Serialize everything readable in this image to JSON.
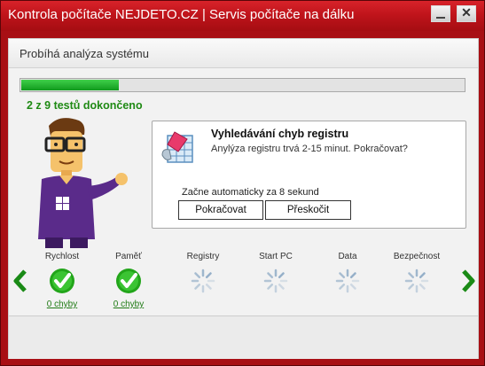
{
  "window": {
    "title": "Kontrola počítače NEJDETO.CZ | Servis počítače na dálku",
    "minimize_icon": "minimize-icon",
    "close_icon": "close-icon",
    "close_glyph": "✕"
  },
  "colors": {
    "titlebar": "#c0141b",
    "progress_green": "#1fb52c",
    "status_green": "#1f8a14",
    "check_green": "#22a51a"
  },
  "panel": {
    "header": "Probíhá analýza systému",
    "progress_fraction": 0.22,
    "count_text": "2 z 9 testů dokončeno"
  },
  "dialog": {
    "icon": "registry-icon",
    "title": "Vyhledávání chyb registru",
    "subtitle": "Anylýza registru trvá 2-15 minut. Pokračovat?",
    "auto_text": "Začne automaticky za 8 sekund",
    "continue_label": "Pokračovat",
    "skip_label": "Přeskočit"
  },
  "steps": [
    {
      "label": "Rychlost",
      "status": "done",
      "icon": "check-icon",
      "link": "0 chyby"
    },
    {
      "label": "Paměť",
      "status": "done",
      "icon": "check-icon",
      "link": "0 chyby"
    },
    {
      "label": "Registry",
      "status": "pending",
      "icon": "spinner-icon",
      "link": ""
    },
    {
      "label": "Start PC",
      "status": "pending",
      "icon": "spinner-icon",
      "link": ""
    },
    {
      "label": "Data",
      "status": "pending",
      "icon": "spinner-icon",
      "link": ""
    },
    {
      "label": "Bezpečnost",
      "status": "pending",
      "icon": "spinner-icon",
      "link": ""
    }
  ],
  "nav": {
    "prev_icon": "chevron-left-icon",
    "next_icon": "chevron-right-icon"
  }
}
